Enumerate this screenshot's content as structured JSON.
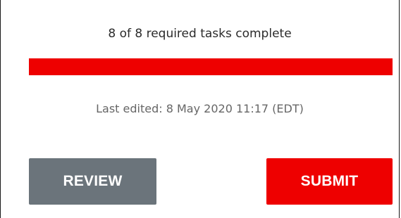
{
  "status": {
    "progress_text": "8 of 8 required tasks complete",
    "completed": 8,
    "required": 8,
    "progress_fraction": 1.0,
    "last_edited": "Last edited: 8 May 2020 11:17 (EDT)"
  },
  "actions": {
    "review_label": "REVIEW",
    "submit_label": "SUBMIT"
  },
  "colors": {
    "accent": "#ee0000",
    "review_button": "#6b747b",
    "text": "#2b2b2b",
    "muted_text": "#666666"
  }
}
